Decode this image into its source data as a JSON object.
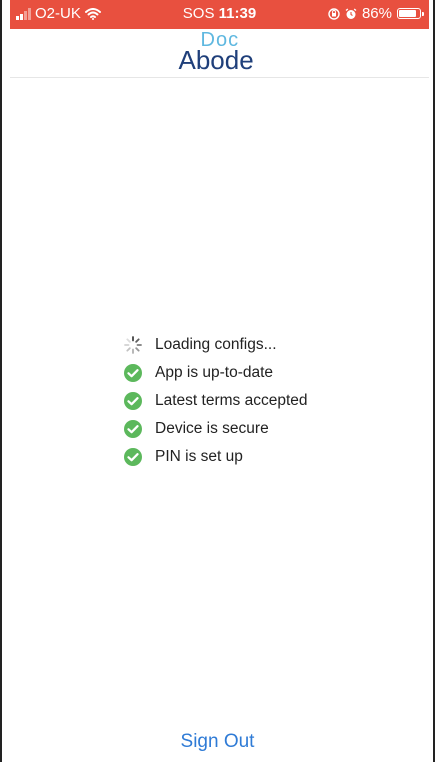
{
  "status_bar": {
    "carrier": "O2-UK",
    "sos": "SOS",
    "time": "11:39",
    "battery": "86%",
    "battery_level": 0.86,
    "background_color": "#e8503f",
    "icons": [
      "signal-bars-icon",
      "wifi-icon",
      "orientation-lock-icon",
      "alarm-icon",
      "battery-icon"
    ]
  },
  "header": {
    "logo_top": "Doc",
    "logo_bottom": "Abode"
  },
  "checklist": {
    "items": [
      {
        "label": "Loading configs...",
        "status": "loading",
        "icon": "spinner-icon"
      },
      {
        "label": "App is up-to-date",
        "status": "done",
        "icon": "check-circle-icon"
      },
      {
        "label": "Latest terms accepted",
        "status": "done",
        "icon": "check-circle-icon"
      },
      {
        "label": "Device is secure",
        "status": "done",
        "icon": "check-circle-icon"
      },
      {
        "label": "PIN is set up",
        "status": "done",
        "icon": "check-circle-icon"
      }
    ],
    "check_color": "#5cb85c"
  },
  "footer": {
    "sign_out_label": "Sign Out",
    "link_color": "#2f7bd6"
  }
}
